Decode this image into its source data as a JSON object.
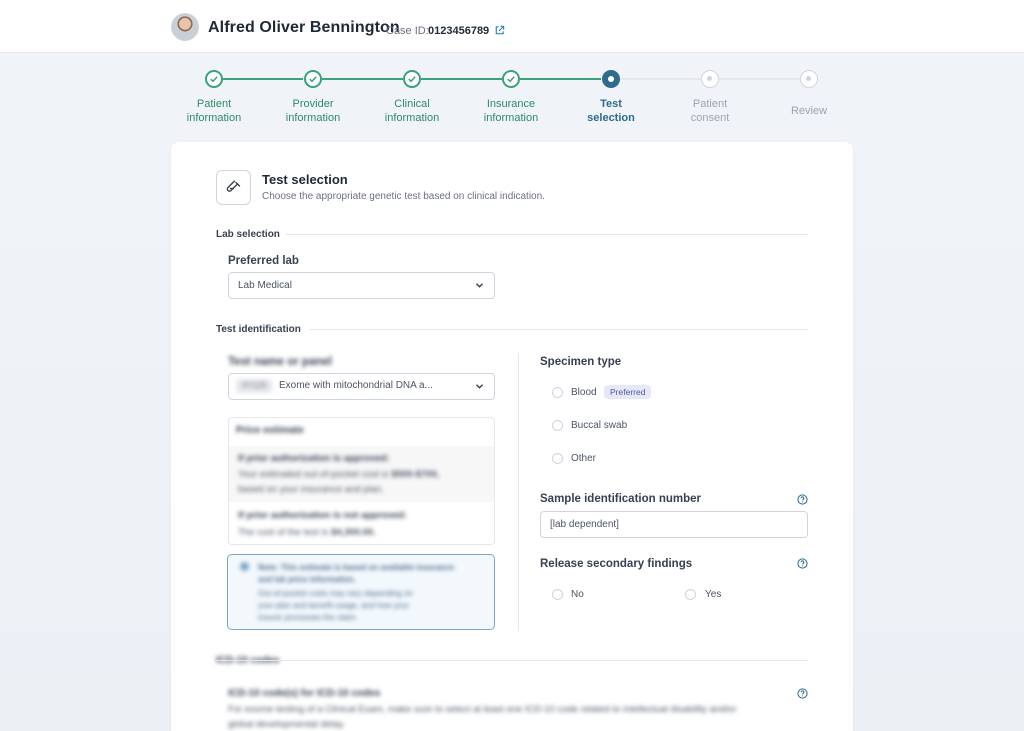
{
  "header": {
    "patient_name": "Alfred Oliver Bennington",
    "case_label": "Case ID:",
    "case_value": "0123456789"
  },
  "stepper": {
    "steps": [
      {
        "line1": "Patient",
        "line2": "information",
        "state": "done"
      },
      {
        "line1": "Provider",
        "line2": "information",
        "state": "done"
      },
      {
        "line1": "Clinical",
        "line2": "information",
        "state": "done"
      },
      {
        "line1": "Insurance",
        "line2": "information",
        "state": "done"
      },
      {
        "line1": "Test",
        "line2": "selection",
        "state": "current"
      },
      {
        "line1": "Patient",
        "line2": "consent",
        "state": "todo"
      },
      {
        "line1": "Review",
        "line2": "",
        "state": "todo"
      }
    ]
  },
  "section": {
    "title": "Test selection",
    "subtitle": "Choose the appropriate genetic test based on clinical indication."
  },
  "lab_selection": {
    "group_title": "Lab selection",
    "preferred_lab_label": "Preferred lab",
    "preferred_lab_value": "Lab Medical"
  },
  "test_identification": {
    "group_title": "Test identification",
    "test_label": "Test name or panel",
    "test_code": "XY123",
    "test_value": "Exome with mitochondrial DNA a...",
    "price": {
      "heading": "Price estimate",
      "approved_title": "If prior authorization is approved:",
      "approved_l1_pre": "Your estimated out-of-pocket cost is",
      "approved_l1_value": "$500-$700,",
      "approved_l2": "based on your insurance and plan.",
      "not_approved_title": "If prior authorization is not approved:",
      "not_approved_pre": "The cost of the test is",
      "not_approved_value": "$4,300.00."
    },
    "info": {
      "line1": "Note: This estimate is based on available insurance",
      "line2": "and lab price information.",
      "line3": "Out-of-pocket costs may vary depending on",
      "line4": "your plan and benefit usage, and how your",
      "line5": "insurer processes the claim."
    }
  },
  "specimen": {
    "label": "Specimen type",
    "options": [
      {
        "label": "Blood"
      },
      {
        "label": "Buccal swab"
      },
      {
        "label": "Other"
      }
    ],
    "preferred_badge": "Preferred"
  },
  "sample_id": {
    "label": "Sample identification number",
    "placeholder": "[lab dependent]"
  },
  "secondary": {
    "label": "Release secondary findings",
    "no": "No",
    "yes": "Yes"
  },
  "icd": {
    "group_title": "ICD-10 codes",
    "field_label": "ICD-10 code(s) for ICD-10 codes",
    "hint": "For exome testing of a Clinical Exam, make sure to select at least one ICD-10 code related to intellectual disability and/or",
    "hint2": "global developmental delay."
  },
  "colors": {
    "done": "#3aa27a",
    "current": "#2e6b8c",
    "todo": "#cbd5e1",
    "badge_bg": "#e6e8f7",
    "badge_text": "#4b5aa8"
  }
}
